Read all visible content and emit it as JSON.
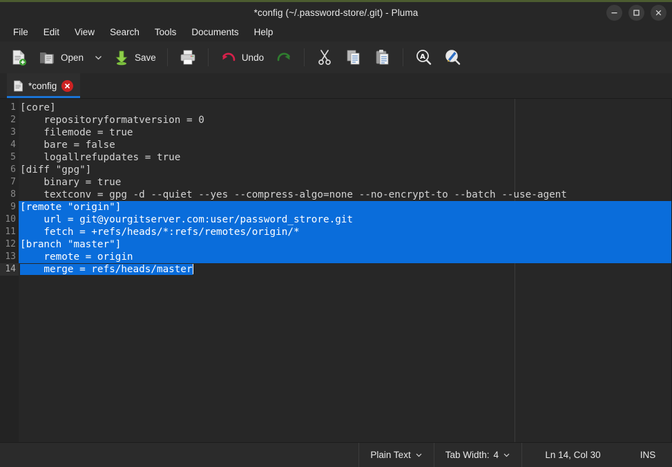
{
  "window": {
    "title": "*config (~/.password-store/.git) - Pluma",
    "accent_color": "#4c5c30",
    "controls": [
      {
        "name": "minimize-button",
        "icon": "minimize-icon"
      },
      {
        "name": "maximize-button",
        "icon": "maximize-icon"
      },
      {
        "name": "close-button",
        "icon": "close-icon"
      }
    ]
  },
  "menubar": {
    "items": [
      {
        "label": "File"
      },
      {
        "label": "Edit"
      },
      {
        "label": "View"
      },
      {
        "label": "Search"
      },
      {
        "label": "Tools"
      },
      {
        "label": "Documents"
      },
      {
        "label": "Help"
      }
    ]
  },
  "toolbar": {
    "new_label": "",
    "open_label": "Open",
    "save_label": "Save",
    "undo_label": "Undo",
    "icons": {
      "new": "new-document-icon",
      "open": "open-folder-icon",
      "open_dropdown": "chevron-down-icon",
      "save": "save-icon",
      "print": "print-icon",
      "undo": "undo-icon",
      "redo": "redo-icon",
      "cut": "cut-icon",
      "copy": "copy-icon",
      "paste": "paste-icon",
      "find": "find-icon",
      "replace": "replace-icon"
    }
  },
  "tabs": [
    {
      "title": "*config",
      "active": true,
      "icon": "document-icon",
      "close_icon": "close-icon"
    }
  ],
  "editor": {
    "selection_color": "#0a6ddb",
    "background_color": "#272727",
    "gutter_color": "#232323",
    "text_color": "#d3d3d3",
    "lines": [
      {
        "n": "1",
        "text": "[core]",
        "sel": false
      },
      {
        "n": "2",
        "text": "    repositoryformatversion = 0",
        "sel": false
      },
      {
        "n": "3",
        "text": "    filemode = true",
        "sel": false
      },
      {
        "n": "4",
        "text": "    bare = false",
        "sel": false
      },
      {
        "n": "5",
        "text": "    logallrefupdates = true",
        "sel": false
      },
      {
        "n": "6",
        "text": "[diff \"gpg\"]",
        "sel": false
      },
      {
        "n": "7",
        "text": "    binary = true",
        "sel": false
      },
      {
        "n": "8",
        "text": "    textconv = gpg -d --quiet --yes --compress-algo=none --no-encrypt-to --batch --use-agent",
        "sel": false
      },
      {
        "n": "9",
        "text": "[remote \"origin\"]",
        "sel": true
      },
      {
        "n": "10",
        "text": "    url = git@yourgitserver.com:user/password_strore.git",
        "sel": true
      },
      {
        "n": "11",
        "text": "    fetch = +refs/heads/*:refs/remotes/origin/*",
        "sel": true
      },
      {
        "n": "12",
        "text": "[branch \"master\"]",
        "sel": true
      },
      {
        "n": "13",
        "text": "    remote = origin",
        "sel": true
      },
      {
        "n": "14",
        "text": "    merge = refs/heads/master",
        "sel": "partial",
        "current": true
      }
    ]
  },
  "statusbar": {
    "language": "Plain Text",
    "tab_width_label": "Tab Width:",
    "tab_width_value": "4",
    "position": "Ln 14, Col 30",
    "insert_mode": "INS",
    "dropdown_icon": "chevron-down-icon"
  }
}
